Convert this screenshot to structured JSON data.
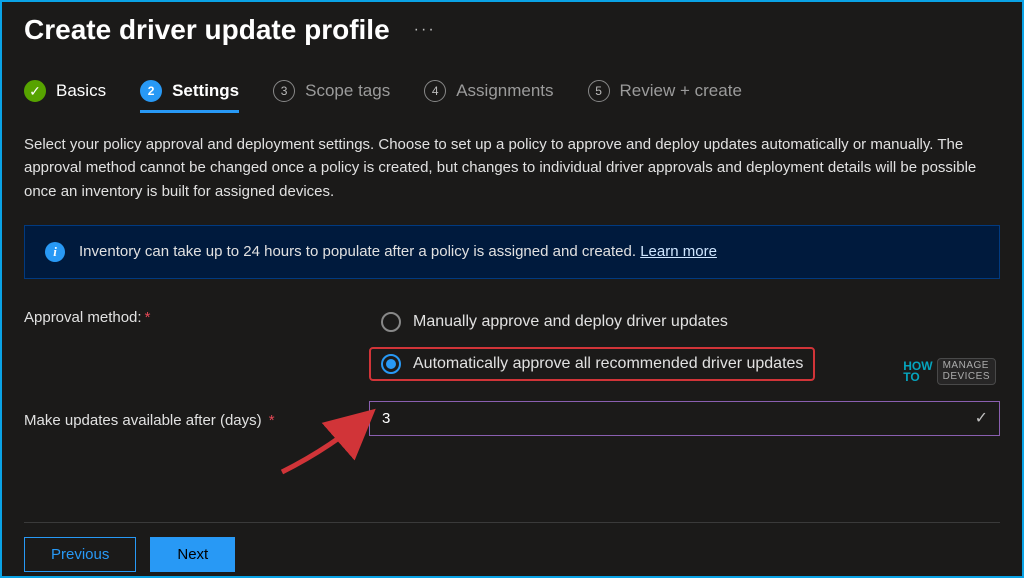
{
  "title": "Create driver update profile",
  "steps": [
    {
      "label": "Basics",
      "state": "done"
    },
    {
      "label": "Settings",
      "state": "active",
      "num": "2"
    },
    {
      "label": "Scope tags",
      "state": "todo",
      "num": "3"
    },
    {
      "label": "Assignments",
      "state": "todo",
      "num": "4"
    },
    {
      "label": "Review + create",
      "state": "todo",
      "num": "5"
    }
  ],
  "description": "Select your policy approval and deployment settings. Choose to set up a policy to approve and deploy updates automatically or manually. The approval method cannot be changed once a policy is created, but changes to individual driver approvals and deployment details will be possible once an inventory is built for assigned devices.",
  "info": {
    "text": "Inventory can take up to 24 hours to populate after a policy is assigned and created.",
    "link": "Learn more"
  },
  "form": {
    "approval_label": "Approval method:",
    "approval_options": {
      "manual": "Manually approve and deploy driver updates",
      "auto": "Automatically approve all recommended driver updates"
    },
    "approval_selected": "auto",
    "delay_label": "Make updates available after (days)",
    "delay_value": "3"
  },
  "footer": {
    "previous": "Previous",
    "next": "Next"
  },
  "watermark": {
    "p1a": "HOW",
    "p1b": "TO",
    "p2a": "MANAGE",
    "p2b": "DEVICES"
  }
}
